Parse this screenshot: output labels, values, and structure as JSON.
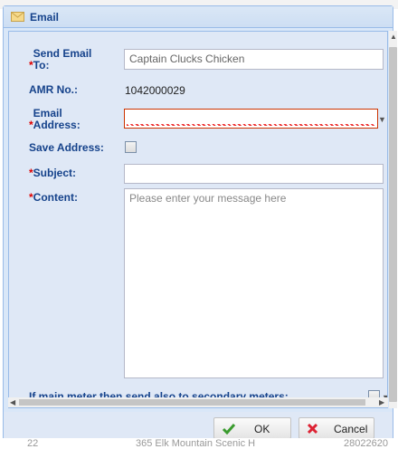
{
  "window": {
    "title": "Email",
    "icon": "envelope-icon"
  },
  "form": {
    "send_to": {
      "label": "Send Email To:",
      "required_mark": "*",
      "value": "Captain Clucks Chicken"
    },
    "amr": {
      "label": "AMR No.:",
      "value": "1042000029"
    },
    "email_address": {
      "label": "Email Address:",
      "required_mark": "*",
      "value": "",
      "state": "invalid"
    },
    "save_address": {
      "label": "Save Address:",
      "checked": false
    },
    "subject": {
      "label": "Subject:",
      "required_mark": "*",
      "value": ""
    },
    "content": {
      "label": "Content:",
      "required_mark": "*",
      "placeholder": "Please enter your message here",
      "value": ""
    },
    "secondary": {
      "label": "If main meter then send also to secondary meters:",
      "checked": false
    }
  },
  "buttons": {
    "ok": "OK",
    "cancel": "Cancel"
  },
  "background_row": {
    "col1": "22",
    "col2": "365 Elk Mountain Scenic H",
    "col3": "28022620"
  }
}
